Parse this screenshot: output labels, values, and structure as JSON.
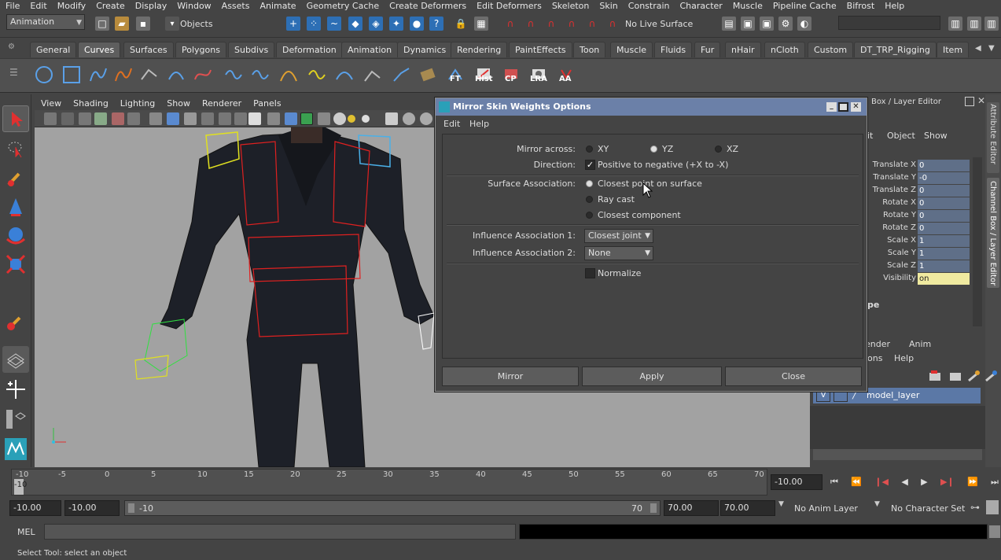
{
  "menubar": [
    "File",
    "Edit",
    "Modify",
    "Create",
    "Display",
    "Window",
    "Assets",
    "Animate",
    "Geometry Cache",
    "Create Deformers",
    "Edit Deformers",
    "Skeleton",
    "Skin",
    "Constrain",
    "Character",
    "Muscle",
    "Pipeline Cache",
    "Bifrost",
    "Help"
  ],
  "status": {
    "menu_set": "Animation",
    "selection_mode": "Objects",
    "live_surface": "No Live Surface"
  },
  "shelf_tabs": [
    "General",
    "Curves",
    "Surfaces",
    "Polygons",
    "Subdivs",
    "Deformation",
    "Animation",
    "Dynamics",
    "Rendering",
    "PaintEffects",
    "Toon",
    "Muscle",
    "Fluids",
    "Fur",
    "nHair",
    "nCloth",
    "Custom",
    "DT_TRP_Rigging",
    "Item"
  ],
  "active_shelf_tab": "Curves",
  "shelf_text_buttons": [
    "FT",
    "Hist",
    "CP",
    "LRA",
    "AA"
  ],
  "viewport_menu": [
    "View",
    "Shading",
    "Lighting",
    "Show",
    "Renderer",
    "Panels"
  ],
  "channel_box": {
    "header": "Box / Layer Editor",
    "menu": [
      "it",
      "Object",
      "Show"
    ],
    "channels": [
      {
        "label": "Translate X",
        "value": "0"
      },
      {
        "label": "Translate Y",
        "value": "-0"
      },
      {
        "label": "Translate Z",
        "value": "0"
      },
      {
        "label": "Rotate X",
        "value": "0"
      },
      {
        "label": "Rotate Y",
        "value": "0"
      },
      {
        "label": "Rotate Z",
        "value": "0"
      },
      {
        "label": "Scale X",
        "value": "1"
      },
      {
        "label": "Scale Y",
        "value": "1"
      },
      {
        "label": "Scale Z",
        "value": "1"
      },
      {
        "label": "Visibility",
        "value": "on"
      }
    ],
    "shapes_label": "pe"
  },
  "side_tabs": [
    "Attribute Editor",
    "Channel Box / Layer Editor"
  ],
  "layer_editor": {
    "tabs": [
      "ender",
      "Anim"
    ],
    "menu": [
      "ons",
      "Help"
    ],
    "layer_name": "model_layer",
    "layer_flag": "V"
  },
  "dialog": {
    "title": "Mirror Skin Weights Options",
    "menu": [
      "Edit",
      "Help"
    ],
    "mirror_across_label": "Mirror across:",
    "mirror_options": [
      "XY",
      "YZ",
      "XZ"
    ],
    "mirror_selected": "YZ",
    "direction_label": "Direction:",
    "direction_text": "Positive to negative (+X to -X)",
    "surface_label": "Surface Association:",
    "surface_options": [
      "Closest point on surface",
      "Ray cast",
      "Closest component"
    ],
    "surface_selected": "Closest point on surface",
    "influence1_label": "Influence Association 1:",
    "influence1_value": "Closest joint",
    "influence2_label": "Influence Association 2:",
    "influence2_value": "None",
    "normalize_label": "Normalize",
    "buttons": [
      "Mirror",
      "Apply",
      "Close"
    ]
  },
  "time_slider": {
    "ticks": [
      "-10",
      "-5",
      "0",
      "5",
      "10",
      "15",
      "20",
      "25",
      "30",
      "35",
      "40",
      "45",
      "50",
      "55",
      "60",
      "65",
      "70"
    ],
    "current": "-10",
    "current_field": "-10.00"
  },
  "range_slider": {
    "start": "-10.00",
    "range_start": "-10.00",
    "bar_start": "-10",
    "bar_end": "70",
    "range_end": "70.00",
    "end": "70.00",
    "anim_layer": "No Anim Layer",
    "character_set": "No Character Set"
  },
  "command_line": {
    "label": "MEL"
  },
  "help_line": "Select Tool: select an object",
  "colors": {
    "dialog_title": "#6b80a8",
    "channel_value": "#5f6f88",
    "visibility_value": "#f0eaa0",
    "viewport_bg": "#a2a2a2",
    "layer_row": "#5b78a6"
  }
}
